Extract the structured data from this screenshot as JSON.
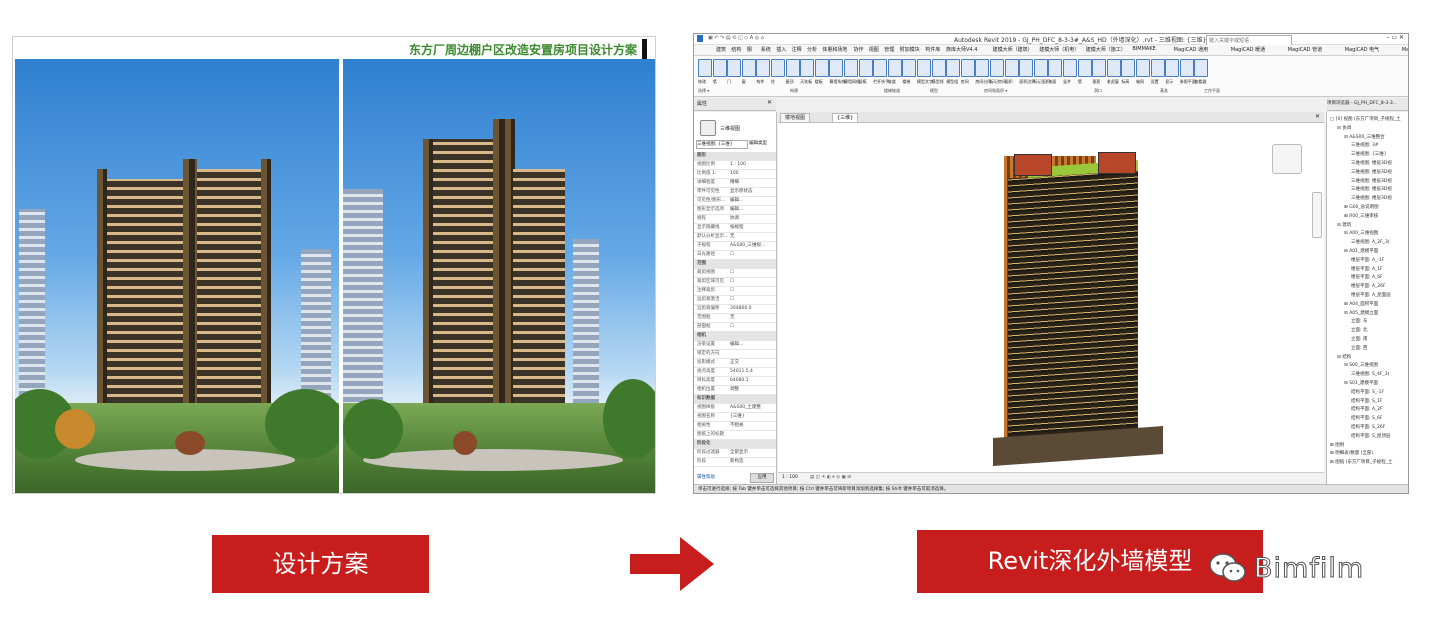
{
  "left": {
    "title": "东方厂周边棚户区改造安置房项目设计方案"
  },
  "revit": {
    "window_title": "Autodesk Revit 2019 - GJ_PH_DFC_8-3-3#_A&S_HD（外墙深化）.rvt - 三维视图: {三维}",
    "search_placeholder": "键入关键字或短语",
    "menu_file": "文件",
    "menu_tabs": [
      "建筑",
      "结构",
      "钢",
      "系统",
      "插入",
      "注释",
      "分析",
      "体量和场地",
      "协作",
      "视图",
      "管理",
      "附加模块",
      "构件库",
      "族库大师V4.4",
      "建模大师（建筑）",
      "建模大师（机电）",
      "建模大师（施工）",
      "BIMMAKE",
      "MagiCAD 通用",
      "MagiCAD 暖通",
      "MagiCAD 管道",
      "MagiCAD 电气",
      "MagiCAD 原理图",
      "MagiCAD 宏传送"
    ],
    "ribbon_buttons": [
      "修改",
      "墙",
      "门",
      "窗",
      "构件",
      "柱",
      "屋顶",
      "天花板",
      "楼板",
      "幕墙系统",
      "幕墙网格",
      "竖梃",
      "栏杆扶手",
      "坡道",
      "楼梯",
      "模型文字",
      "模型线",
      "模型组",
      "房间",
      "房间分隔",
      "标记房间",
      "面积",
      "面积边界",
      "标记面积",
      "按面",
      "竖井",
      "墙",
      "垂直",
      "老虎窗",
      "标高",
      "轴网",
      "设置",
      "显示",
      "参照平面",
      "查看器"
    ],
    "ribbon_groups": [
      "选择 ▾",
      "构建",
      "楼梯坡道",
      "模型",
      "房间和面积 ▾",
      "洞口",
      "基准",
      "工作平面"
    ],
    "properties": {
      "header": "属性",
      "type_name": "三维视图",
      "selector": "三维视图: {三维}",
      "edit_type": "编辑类型",
      "rows": [
        {
          "k": "图形",
          "v": "",
          "head": true
        },
        {
          "k": "视图比例",
          "v": "1 : 100"
        },
        {
          "k": "比例值 1:",
          "v": "100"
        },
        {
          "k": "详细程度",
          "v": "精细"
        },
        {
          "k": "零件可见性",
          "v": "显示原状态"
        },
        {
          "k": "可见性/图形...",
          "v": "编辑..."
        },
        {
          "k": "图形显示选项",
          "v": "编辑..."
        },
        {
          "k": "规程",
          "v": "协调"
        },
        {
          "k": "显示隐藏线",
          "v": "按规程"
        },
        {
          "k": "默认分析显示...",
          "v": "无"
        },
        {
          "k": "子规程",
          "v": "A&S00_三维视..."
        },
        {
          "k": "日光路径",
          "v": "☐"
        },
        {
          "k": "范围",
          "v": "",
          "head": true
        },
        {
          "k": "裁剪视图",
          "v": "☐"
        },
        {
          "k": "裁剪区域可见",
          "v": "☐"
        },
        {
          "k": "注释裁剪",
          "v": "☐"
        },
        {
          "k": "远剪裁激活",
          "v": "☐"
        },
        {
          "k": "远剪裁偏移",
          "v": "304800.0"
        },
        {
          "k": "范围框",
          "v": "无"
        },
        {
          "k": "剖面框",
          "v": "☐"
        },
        {
          "k": "相机",
          "v": "",
          "head": true
        },
        {
          "k": "渲染设置",
          "v": "编辑..."
        },
        {
          "k": "锁定的方向",
          "v": ""
        },
        {
          "k": "投影模式",
          "v": "正交"
        },
        {
          "k": "视点高度",
          "v": "54011.5.4"
        },
        {
          "k": "目标高度",
          "v": "64080.1"
        },
        {
          "k": "相机位置",
          "v": "调整"
        },
        {
          "k": "标识数据",
          "v": "",
          "head": true
        },
        {
          "k": "视图样板",
          "v": "A&S00_土建整"
        },
        {
          "k": "视图名称",
          "v": "{三维}"
        },
        {
          "k": "相关性",
          "v": "不相关"
        },
        {
          "k": "图纸上的标题",
          "v": ""
        },
        {
          "k": "阶段化",
          "v": "",
          "head": true
        },
        {
          "k": "阶段过滤器",
          "v": "全部显示"
        },
        {
          "k": "阶段",
          "v": "新构造"
        }
      ],
      "help_link": "属性帮助",
      "apply": "应用"
    },
    "view_tabs": [
      "楼地视图",
      "{三维}"
    ],
    "browser": {
      "header": "项目浏览器 - GJ_PH_DFC_8-3-3...",
      "items": [
        {
          "t": "□ [0] 视图 (东方厂项目_子规程_土",
          "d": 0
        },
        {
          "t": "⊟ 协调",
          "d": 1
        },
        {
          "t": "⊟ A&S00_三维整合",
          "d": 2
        },
        {
          "t": "三维视图: 3#",
          "d": 3
        },
        {
          "t": "三维视图: {三维}",
          "d": 3
        },
        {
          "t": "三维视图: 楼层3D视",
          "d": 3
        },
        {
          "t": "三维视图: 楼层3D视",
          "d": 3
        },
        {
          "t": "三维视图: 楼层3D视",
          "d": 3
        },
        {
          "t": "三维视图: 楼层3D视",
          "d": 3
        },
        {
          "t": "三维视图: 楼层3D视",
          "d": 3
        },
        {
          "t": "⊞ G00_总说明图",
          "d": 2
        },
        {
          "t": "⊞ R00_三维审核",
          "d": 2
        },
        {
          "t": "⊟ 建筑",
          "d": 1
        },
        {
          "t": "⊟ A00_三维视图",
          "d": 2
        },
        {
          "t": "三维视图: A_2F_3(",
          "d": 3
        },
        {
          "t": "⊟ A01_建模平面",
          "d": 2
        },
        {
          "t": "楼层平面: A_-1F",
          "d": 3
        },
        {
          "t": "楼层平面: A_1F",
          "d": 3
        },
        {
          "t": "楼层平面: A_6F",
          "d": 3
        },
        {
          "t": "楼层平面: A_26F",
          "d": 3
        },
        {
          "t": "楼层平面: A_屋面层",
          "d": 3
        },
        {
          "t": "⊞ A04_面积平面",
          "d": 2
        },
        {
          "t": "⊟ A05_建模立面",
          "d": 2
        },
        {
          "t": "立面: 东",
          "d": 3
        },
        {
          "t": "立面: 北",
          "d": 3
        },
        {
          "t": "立面: 南",
          "d": 3
        },
        {
          "t": "立面: 西",
          "d": 3
        },
        {
          "t": "⊟ 结构",
          "d": 1
        },
        {
          "t": "⊟ S00_三维视图",
          "d": 2
        },
        {
          "t": "三维视图: S_4F_3(",
          "d": 3
        },
        {
          "t": "⊟ S01_建模平面",
          "d": 2
        },
        {
          "t": "结构平面: S_-1F",
          "d": 3
        },
        {
          "t": "结构平面: S_1F",
          "d": 3
        },
        {
          "t": "结构平面: A_2F",
          "d": 3
        },
        {
          "t": "结构平面: S_6F",
          "d": 3
        },
        {
          "t": "结构平面: S_26F",
          "d": 3
        },
        {
          "t": "结构平面: S_屋顶层",
          "d": 3
        },
        {
          "t": "⊞ 图例",
          "d": 0
        },
        {
          "t": "⊞ 明细表/数量 (全部)",
          "d": 0
        },
        {
          "t": "⊞ 图纸 (东方厂项目_子规程_土",
          "d": 0
        }
      ]
    },
    "viewbar_scale": "1 : 100",
    "status_text": "单击可进行选择; 按 Tab 键并单击可选择其他项目; 按 Ctrl 键并单击可将新项目添加到选择集; 按 Shift 键并单击可取消选择。",
    "model_name": "主模型"
  },
  "labels": {
    "left": "设计方案",
    "right": "Revit深化外墙模型"
  },
  "watermark": "Bimfilm",
  "colors": {
    "label_red": "#c81d1d",
    "title_green": "#3c8a2e"
  }
}
